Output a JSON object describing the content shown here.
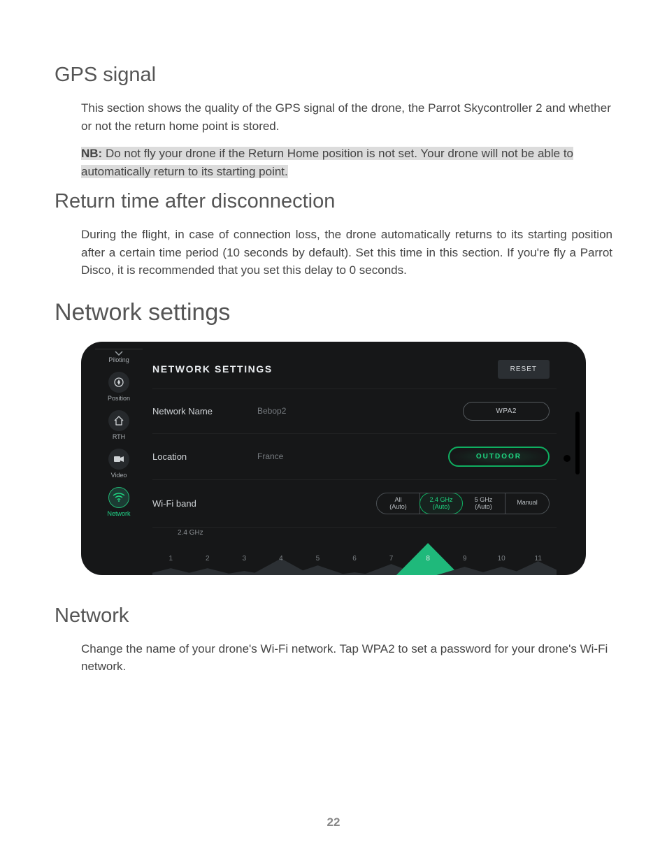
{
  "sections": {
    "gps": {
      "heading": "GPS signal",
      "body": "This section shows the quality of the GPS signal of the drone, the Parrot Skycontroller 2 and whether or not the return home point is stored.",
      "note_prefix": "NB:",
      "note_body": " Do not fly your drone if the Return Home position is not set. Your drone will not be able to automatically return to its starting point."
    },
    "return_time": {
      "heading": "Return time after disconnection",
      "body": "During the flight, in case of connection loss, the drone automatically returns to its starting position after a certain time period (10 seconds by default). Set this time in this section. If you're fly a Parrot Disco, it is recommended that you set this delay to 0 seconds."
    },
    "network_settings": {
      "heading": "Network settings"
    },
    "network": {
      "heading": "Network",
      "body": "Change the name of your drone's Wi-Fi network. Tap WPA2 to set a password for your drone's Wi-Fi network."
    }
  },
  "phone": {
    "sidebar": {
      "items": [
        {
          "label": "Piloting"
        },
        {
          "label": "Position"
        },
        {
          "label": "RTH"
        },
        {
          "label": "Video"
        },
        {
          "label": "Network"
        }
      ]
    },
    "title": "NETWORK SETTINGS",
    "reset": "RESET",
    "rows": {
      "name_label": "Network Name",
      "name_value": "Bebop2",
      "name_button": "WPA2",
      "loc_label": "Location",
      "loc_value": "France",
      "loc_button": "OUTDOOR",
      "band_label": "Wi-Fi band"
    },
    "band_options": {
      "o1a": "All",
      "o1b": "(Auto)",
      "o2a": "2.4 GHz",
      "o2b": "(Auto)",
      "o3a": "5 GHz",
      "o3b": "(Auto)",
      "o4": "Manual"
    },
    "chart": {
      "band_label": "2.4 GHz",
      "channels": [
        "1",
        "2",
        "3",
        "4",
        "5",
        "6",
        "7",
        "8",
        "9",
        "10",
        "11"
      ],
      "heights": [
        12,
        12,
        8,
        26,
        16,
        6,
        18,
        48,
        14,
        14,
        22
      ],
      "selected_index": 7
    }
  },
  "page_number": "22"
}
